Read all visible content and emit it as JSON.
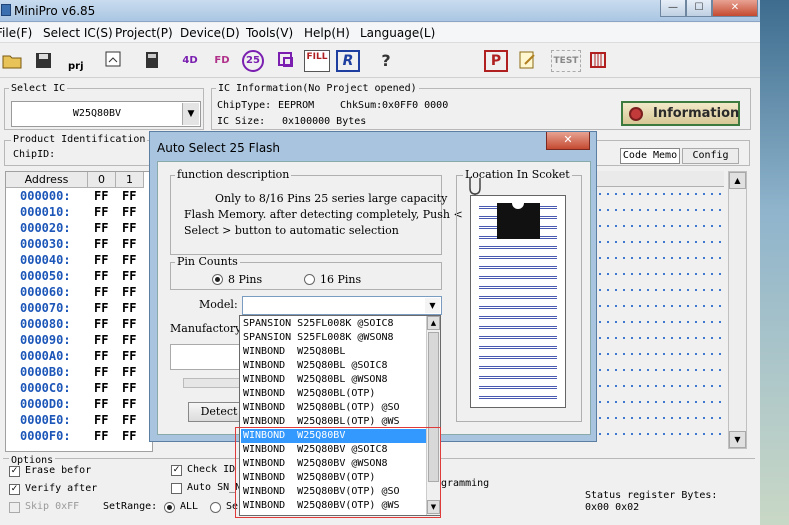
{
  "window": {
    "title": "MiniPro v6.85"
  },
  "menu": [
    "File(F)",
    "Select IC(S)",
    "Project(P)",
    "Device(D)",
    "Tools(V)",
    "Help(H)",
    "Language(L)"
  ],
  "toolbar": {
    "prj_label": "prj",
    "fill_label": "FILL",
    "r_label": "R",
    "p_label": "P",
    "test_label": "TEST",
    "help_glyph": "?",
    "fd_label": "FD",
    "count_label": "25"
  },
  "select_ic": {
    "group_title": "Select IC",
    "value": "W25Q80BV"
  },
  "ic_info": {
    "group_title": "IC Information(No Project opened)",
    "chiptype_label": "ChipType:",
    "chiptype_value": "EEPROM",
    "checksum_label": "ChkSum:",
    "checksum_value": "0x0FF0 0000",
    "size_label": "IC Size:",
    "size_value": "0x100000 Bytes"
  },
  "information_button": "Information",
  "product_id": {
    "title": "Product Identification",
    "chipid_label": "ChipID:"
  },
  "right_buttons": {
    "code_memo": "Code Memo",
    "config": "Config"
  },
  "hex": {
    "columns": [
      "Address",
      "0",
      "1"
    ],
    "rows": [
      {
        "addr": "000000:",
        "b0": "FF",
        "b1": "FF"
      },
      {
        "addr": "000010:",
        "b0": "FF",
        "b1": "FF"
      },
      {
        "addr": "000020:",
        "b0": "FF",
        "b1": "FF"
      },
      {
        "addr": "000030:",
        "b0": "FF",
        "b1": "FF"
      },
      {
        "addr": "000040:",
        "b0": "FF",
        "b1": "FF"
      },
      {
        "addr": "000050:",
        "b0": "FF",
        "b1": "FF"
      },
      {
        "addr": "000060:",
        "b0": "FF",
        "b1": "FF"
      },
      {
        "addr": "000070:",
        "b0": "FF",
        "b1": "FF"
      },
      {
        "addr": "000080:",
        "b0": "FF",
        "b1": "FF"
      },
      {
        "addr": "000090:",
        "b0": "FF",
        "b1": "FF"
      },
      {
        "addr": "0000A0:",
        "b0": "FF",
        "b1": "FF"
      },
      {
        "addr": "0000B0:",
        "b0": "FF",
        "b1": "FF"
      },
      {
        "addr": "0000C0:",
        "b0": "FF",
        "b1": "FF"
      },
      {
        "addr": "0000D0:",
        "b0": "FF",
        "b1": "FF"
      },
      {
        "addr": "0000E0:",
        "b0": "FF",
        "b1": "FF"
      },
      {
        "addr": "0000F0:",
        "b0": "FF",
        "b1": "FF"
      }
    ]
  },
  "options": {
    "title": "Options",
    "erase_before": "Erase befor",
    "verify_after": "Verify after",
    "skip_0xff": "Skip 0xFF",
    "check_id": "Check ID",
    "auto_sn": "Auto SN_N",
    "setrange_label": "SetRange:",
    "range_all": "ALL",
    "range_se": "Se",
    "programming": "gramming",
    "status_label": "Status register Bytes:",
    "status_value": "0x00 0x02"
  },
  "dialog": {
    "title": "Auto Select 25 Flash",
    "close_glyph": "✕",
    "function_title": "function description",
    "function_text": "Only to 8/16 Pins 25 series large capacity",
    "function_text2": "Flash Memory. after detecting completely, Push <",
    "function_text3": "Select > button to automatic selection",
    "pin_counts_title": "Pin Counts",
    "pins_8": "8 Pins",
    "pins_16": "16 Pins",
    "model_label": "Model:",
    "model_value": "",
    "manufactory_label": "Manufactory",
    "detect_button": "Detect",
    "location_title": "Location In Scoket"
  },
  "dropdown": {
    "items": [
      "SPANSION S25FL008K @SOIC8",
      "SPANSION S25FL008K @WSON8",
      "WINBOND  W25Q80BL",
      "WINBOND  W25Q80BL @SOIC8",
      "WINBOND  W25Q80BL @WSON8",
      "WINBOND  W25Q80BL(OTP)",
      "WINBOND  W25Q80BL(OTP) @SO",
      "WINBOND  W25Q80BL(OTP) @WS",
      "WINBOND  W25Q80BV",
      "WINBOND  W25Q80BV @SOIC8",
      "WINBOND  W25Q80BV @WSON8",
      "WINBOND  W25Q80BV(OTP)",
      "WINBOND  W25Q80BV(OTP) @SO",
      "WINBOND  W25Q80BV(OTP) @WS"
    ],
    "selected_index": 8
  },
  "colors": {
    "selection": "#3399ff",
    "highlight_frame": "#e03a3a",
    "hex_address": "#1c56b8"
  }
}
